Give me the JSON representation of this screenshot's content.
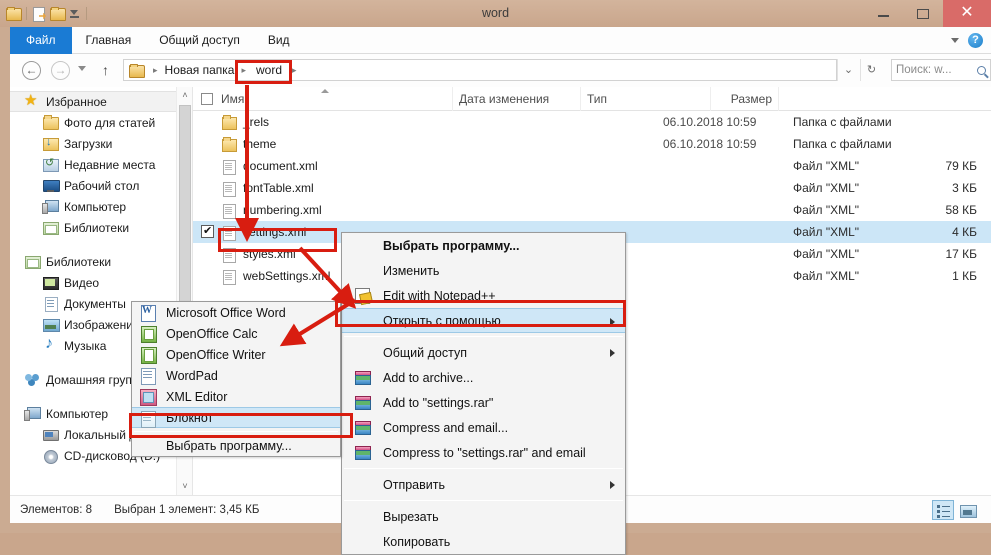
{
  "window": {
    "title": "word",
    "quick_access": [
      "folder-icon",
      "new-folder-icon",
      "folder-icon",
      "chevron-down-icon"
    ],
    "minimize_label": "–",
    "maximize_label": "□",
    "close_label": "✕"
  },
  "ribbon": {
    "tabs": [
      {
        "label": "Файл",
        "active": true
      },
      {
        "label": "Главная",
        "active": false
      },
      {
        "label": "Общий доступ",
        "active": false
      },
      {
        "label": "Вид",
        "active": false
      }
    ],
    "help_label": "?",
    "accent_color": "#1a7bd4"
  },
  "address_bar": {
    "back_icon": "←",
    "forward_icon": "→",
    "up_icon": "↑",
    "crumbs": [
      "Новая папка",
      "word"
    ],
    "crumb_separator": "▸",
    "highlighted_crumb": "word",
    "refresh_icon": "↻",
    "dropdown_icon": "⌄"
  },
  "search": {
    "placeholder": "Поиск: w...",
    "icon": "search-icon"
  },
  "sidebar": {
    "groups": [
      {
        "root": {
          "label": "Избранное",
          "icon": "star-icon",
          "selected": true
        },
        "items": [
          {
            "label": "Фото для статей",
            "icon": "folder-icon"
          },
          {
            "label": "Загрузки",
            "icon": "downloads-icon"
          },
          {
            "label": "Недавние места",
            "icon": "recent-places-icon"
          },
          {
            "label": "Рабочий стол",
            "icon": "desktop-icon"
          },
          {
            "label": "Компьютер",
            "icon": "computer-icon"
          },
          {
            "label": "Библиотеки",
            "icon": "libraries-icon"
          }
        ]
      },
      {
        "root": {
          "label": "Библиотеки",
          "icon": "libraries-icon",
          "selected": false
        },
        "items": [
          {
            "label": "Видео",
            "icon": "video-icon"
          },
          {
            "label": "Документы",
            "icon": "documents-icon"
          },
          {
            "label": "Изображения",
            "icon": "pictures-icon"
          },
          {
            "label": "Музыка",
            "icon": "music-icon"
          }
        ]
      },
      {
        "root": {
          "label": "Домашняя груп",
          "icon": "homegroup-icon",
          "selected": false
        },
        "items": []
      },
      {
        "root": {
          "label": "Компьютер",
          "icon": "computer-icon",
          "selected": false
        },
        "items": [
          {
            "label": "Локальный диск (C:)",
            "icon": "hard-drive-icon"
          },
          {
            "label": "CD-дисковод (D:)",
            "icon": "cd-drive-icon"
          }
        ]
      }
    ],
    "scroll_up_icon": "˄",
    "scroll_down_icon": "˅"
  },
  "filelist": {
    "columns": [
      "Имя",
      "Дата изменения",
      "Тип",
      "Размер"
    ],
    "sort_column": "Имя",
    "sort_direction": "ascending",
    "rows": [
      {
        "name": "_rels",
        "date": "06.10.2018 10:59",
        "type": "Папка с файлами",
        "size": "",
        "icon": "folder-icon",
        "selected": false,
        "checked": false
      },
      {
        "name": "theme",
        "date": "06.10.2018 10:59",
        "type": "Папка с файлами",
        "size": "",
        "icon": "folder-icon",
        "selected": false,
        "checked": false
      },
      {
        "name": "document.xml",
        "date": "",
        "type": "Файл \"XML\"",
        "size": "79 КБ",
        "icon": "xml-file-icon",
        "selected": false,
        "checked": false
      },
      {
        "name": "fontTable.xml",
        "date": "",
        "type": "Файл \"XML\"",
        "size": "3 КБ",
        "icon": "xml-file-icon",
        "selected": false,
        "checked": false
      },
      {
        "name": "numbering.xml",
        "date": "",
        "type": "Файл \"XML\"",
        "size": "58 КБ",
        "icon": "xml-file-icon",
        "selected": false,
        "checked": false
      },
      {
        "name": "settings.xml",
        "date": "",
        "type": "Файл \"XML\"",
        "size": "4 КБ",
        "icon": "xml-file-icon",
        "selected": true,
        "checked": true
      },
      {
        "name": "styles.xml",
        "date": "",
        "type": "Файл \"XML\"",
        "size": "17 КБ",
        "icon": "xml-file-icon",
        "selected": false,
        "checked": false
      },
      {
        "name": "webSettings.xml",
        "date": "",
        "type": "Файл \"XML\"",
        "size": "1 КБ",
        "icon": "xml-file-icon",
        "selected": false,
        "checked": false
      }
    ]
  },
  "context_menu": {
    "items": [
      {
        "label": "Выбрать программу...",
        "bold": true,
        "icon": "",
        "submenu": false,
        "highlighted": false
      },
      {
        "label": "Изменить",
        "bold": false,
        "icon": "",
        "submenu": false,
        "highlighted": false
      },
      {
        "label": "Edit with Notepad++",
        "bold": false,
        "icon": "notepadpp-icon",
        "submenu": false,
        "highlighted": false
      },
      {
        "label": "Открыть с помощью",
        "bold": false,
        "icon": "",
        "submenu": true,
        "highlighted": true
      },
      {
        "separator": true
      },
      {
        "label": "Общий доступ",
        "bold": false,
        "icon": "",
        "submenu": true,
        "highlighted": false
      },
      {
        "label": "Add to archive...",
        "bold": false,
        "icon": "winrar-icon",
        "submenu": false,
        "highlighted": false
      },
      {
        "label": "Add to \"settings.rar\"",
        "bold": false,
        "icon": "winrar-icon",
        "submenu": false,
        "highlighted": false
      },
      {
        "label": "Compress and email...",
        "bold": false,
        "icon": "winrar-icon",
        "submenu": false,
        "highlighted": false
      },
      {
        "label": "Compress to \"settings.rar\" and email",
        "bold": false,
        "icon": "winrar-icon",
        "submenu": false,
        "highlighted": false
      },
      {
        "separator": true
      },
      {
        "label": "Отправить",
        "bold": false,
        "icon": "",
        "submenu": true,
        "highlighted": false
      },
      {
        "separator": true
      },
      {
        "label": "Вырезать",
        "bold": false,
        "icon": "",
        "submenu": false,
        "highlighted": false
      },
      {
        "label": "Копировать",
        "bold": false,
        "icon": "",
        "submenu": false,
        "highlighted": false
      }
    ]
  },
  "open_with_submenu": {
    "items": [
      {
        "label": "Microsoft Office Word",
        "icon": "word-icon",
        "highlighted": false
      },
      {
        "label": "OpenOffice Calc",
        "icon": "openoffice-calc-icon",
        "highlighted": false
      },
      {
        "label": "OpenOffice Writer",
        "icon": "openoffice-writer-icon",
        "highlighted": false
      },
      {
        "label": "WordPad",
        "icon": "wordpad-icon",
        "highlighted": false
      },
      {
        "label": "XML Editor",
        "icon": "xml-editor-icon",
        "highlighted": false
      },
      {
        "label": "Блокнот",
        "icon": "notepad-icon",
        "highlighted": true
      },
      {
        "separator": true
      },
      {
        "label": "Выбрать программу...",
        "icon": "",
        "highlighted": false
      }
    ]
  },
  "status_bar": {
    "items_count": "Элементов: 8",
    "selection": "Выбран 1 элемент: 3,45 КБ",
    "view_details_icon": "details-view-icon",
    "view_large_icon": "large-icons-view-icon"
  },
  "annotation": {
    "color": "#d81d10",
    "boxes": [
      "word-breadcrumb",
      "settings-xml-row",
      "open-with-item",
      "notepad-item"
    ],
    "arrows": [
      "breadcrumb-to-settings",
      "settings-to-open-with",
      "open-with-to-notepad"
    ]
  }
}
